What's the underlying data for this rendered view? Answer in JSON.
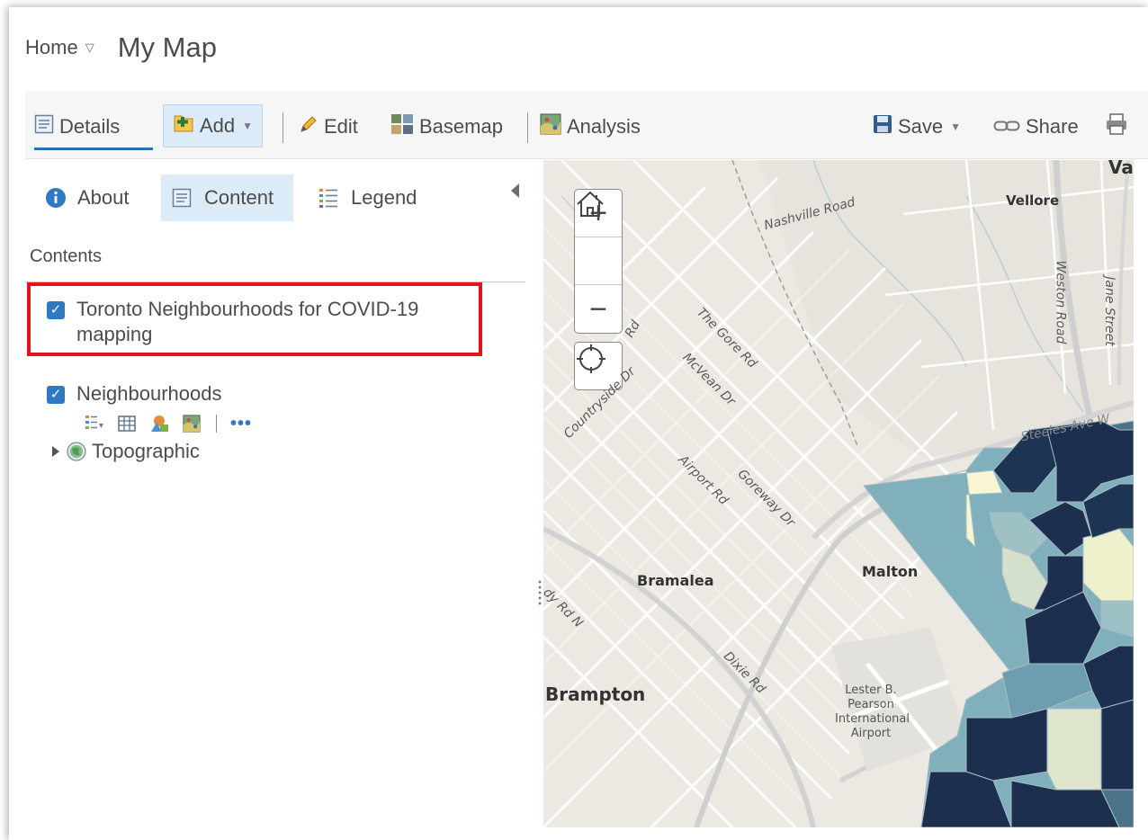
{
  "header": {
    "home_label": "Home",
    "home_caret": "▽",
    "map_title": "My Map"
  },
  "toolbar": {
    "details": "Details",
    "add": "Add",
    "edit": "Edit",
    "basemap": "Basemap",
    "analysis": "Analysis",
    "save": "Save",
    "share": "Share",
    "print_icon": "print-icon"
  },
  "panel": {
    "tabs": {
      "about": "About",
      "content": "Content",
      "legend": "Legend"
    },
    "contents_heading": "Contents",
    "layers": [
      {
        "name": "Toronto Neighbourhoods for COVID-19 mapping",
        "checked": true,
        "highlighted": true
      },
      {
        "name": "Neighbourhoods",
        "checked": true
      },
      {
        "name": "Topographic",
        "expandable": true
      }
    ],
    "layer_tools": [
      "show-legend-icon",
      "table-icon",
      "change-style-icon",
      "analysis-icon"
    ],
    "more_label": "•••"
  },
  "map": {
    "zoom_in": "+",
    "zoom_out": "−",
    "labels": {
      "nashville_road": "Nashville Road",
      "vellore": "Vellore",
      "va": "Va",
      "weston_road": "Weston Road",
      "jane_street": "Jane Street",
      "the_gore_rd": "The Gore Rd",
      "mcvean_dr": "McVean Dr",
      "countryside_dr": "Countryside Dr",
      "airport_rd": "Airport Rd",
      "goreway_dr": "Goreway Dr",
      "bramalea": "Bramalea",
      "malton": "Malton",
      "dixie_rd": "Dixie Rd",
      "brampton": "Brampton",
      "airport_line1": "Lester B.",
      "airport_line2": "Pearson",
      "airport_line3": "International",
      "airport_line4": "Airport",
      "rd_n": "dy Rd N",
      "steeles": "Steeles Ave W",
      "rd_frag": "Rd"
    }
  },
  "colors": {
    "accent": "#2b6fb3",
    "highlight_border": "#e8121a",
    "choropleth_dark": "#1c2f4f",
    "choropleth_mid": "#7fb0bd",
    "choropleth_light": "#f6f5d6"
  }
}
